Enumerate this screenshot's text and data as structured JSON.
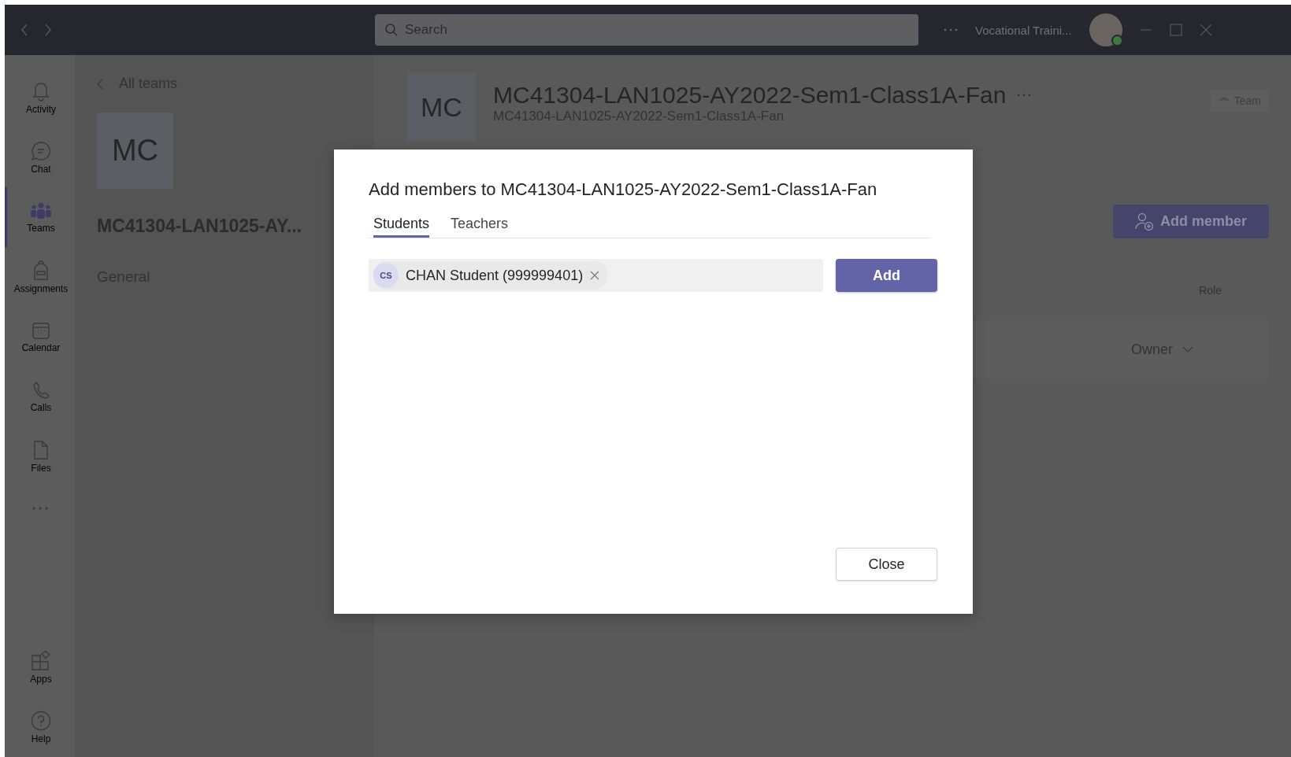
{
  "title_bar": {
    "search": {
      "placeholder": "Search"
    },
    "organization": "Vocational Traini..."
  },
  "app_bar": {
    "items": [
      {
        "kind": "bell",
        "label": "Activity",
        "selected": false
      },
      {
        "kind": "chat",
        "label": "Chat",
        "selected": false
      },
      {
        "kind": "teams",
        "label": "Teams",
        "selected": true
      },
      {
        "kind": "backpack",
        "label": "Assignments",
        "selected": false
      },
      {
        "kind": "calendar",
        "label": "Calendar",
        "selected": false
      },
      {
        "kind": "phone",
        "label": "Calls",
        "selected": false
      },
      {
        "kind": "file",
        "label": "Files",
        "selected": false
      }
    ],
    "bottom_items": [
      {
        "kind": "apps",
        "label": "Apps"
      },
      {
        "kind": "help",
        "label": "Help"
      }
    ]
  },
  "team_panel": {
    "back_link": "All teams",
    "initials": "MC",
    "team_name": "MC41304-LAN1025-AY...",
    "channels": [
      "General"
    ]
  },
  "header": {
    "initials": "MC",
    "title": "MC41304-LAN1025-AY2022-Sem1-Class1A-Fan",
    "subtitle": "MC41304-LAN1025-AY2022-Sem1-Class1A-Fan",
    "team_badge": "Team"
  },
  "add_member_button": "Add member",
  "members_table": {
    "columns": [
      "Role"
    ],
    "rows": [
      {
        "role": "Owner"
      }
    ]
  },
  "dialog": {
    "title": "Add members to MC41304-LAN1025-AY2022-Sem1-Class1A-Fan",
    "tabs": [
      {
        "label": "Students",
        "selected": true
      },
      {
        "label": "Teachers",
        "selected": false
      }
    ],
    "chips": [
      {
        "initials": "CS",
        "name": "CHAN Student (999999401)"
      }
    ],
    "add_button": "Add",
    "close_button": "Close"
  }
}
